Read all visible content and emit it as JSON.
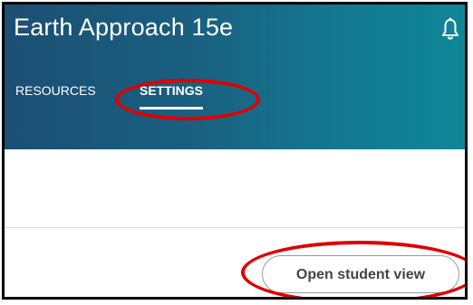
{
  "course": {
    "title": "Earth Approach 15e"
  },
  "header": {
    "notification_icon": "bell-icon"
  },
  "tabs": [
    {
      "label": "RESOURCES",
      "active": false
    },
    {
      "label": "SETTINGS",
      "active": true
    }
  ],
  "actions": {
    "student_view_label": "Open student view"
  },
  "colors": {
    "header_start": "#1b4f73",
    "header_end": "#0f8698",
    "annotation": "#e00000"
  }
}
